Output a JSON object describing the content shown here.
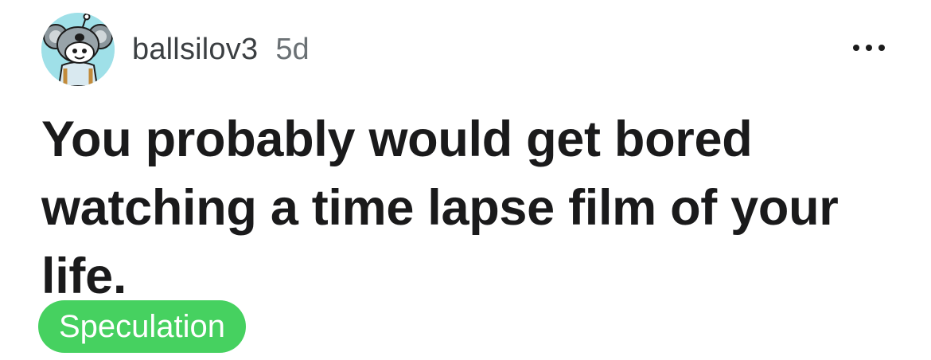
{
  "post": {
    "author": "ballsilov3",
    "age": "5d",
    "title": "You probably would get bored watching a time lapse film of your life.",
    "flair": "Speculation"
  },
  "icons": {
    "avatar": "snoo-koala-avatar",
    "more": "more-options-icon"
  },
  "colors": {
    "flair_bg": "#46d160",
    "avatar_bg": "#9fe0e8"
  }
}
